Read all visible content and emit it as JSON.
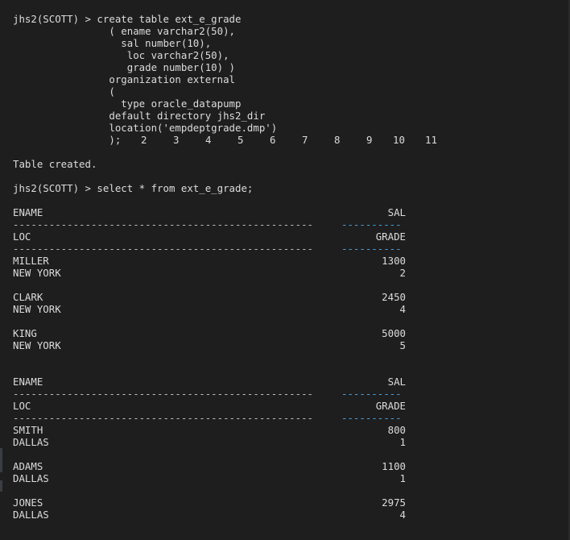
{
  "terminal": {
    "create_lines": [
      "jhs2(SCOTT) > create table ext_e_grade",
      "                ( ename varchar2(50),",
      "                  sal number(10),",
      "                   loc varchar2(50),",
      "                   grade number(10) )",
      "                organization external",
      "                (",
      "                  type oracle_datapump",
      "                default directory jhs2_dir",
      "                location('empdeptgrade.dmp')",
      "                );"
    ],
    "line_numbers": [
      "2",
      "3",
      "4",
      "5",
      "6",
      "7",
      "8",
      "9",
      "10",
      "11"
    ],
    "table_created": "Table created.",
    "select_line": "jhs2(SCOTT) > select * from ext_e_grade;",
    "headers": {
      "ename": "ENAME",
      "sal": "SAL",
      "loc": "LOC",
      "grade": "GRADE"
    },
    "dash_left": "--------------------------------------------------",
    "dash_right": "----------",
    "page1_rows": [
      {
        "ename": "MILLER",
        "sal": "1300",
        "loc": "NEW YORK",
        "grade": "2"
      },
      {
        "ename": "CLARK",
        "sal": "2450",
        "loc": "NEW YORK",
        "grade": "4"
      },
      {
        "ename": "KING",
        "sal": "5000",
        "loc": "NEW YORK",
        "grade": "5"
      }
    ],
    "page2_rows": [
      {
        "ename": "SMITH",
        "sal": "800",
        "loc": "DALLAS",
        "grade": "1"
      },
      {
        "ename": "ADAMS",
        "sal": "1100",
        "loc": "DALLAS",
        "grade": "1"
      },
      {
        "ename": "JONES",
        "sal": "2975",
        "loc": "DALLAS",
        "grade": "4"
      }
    ]
  }
}
